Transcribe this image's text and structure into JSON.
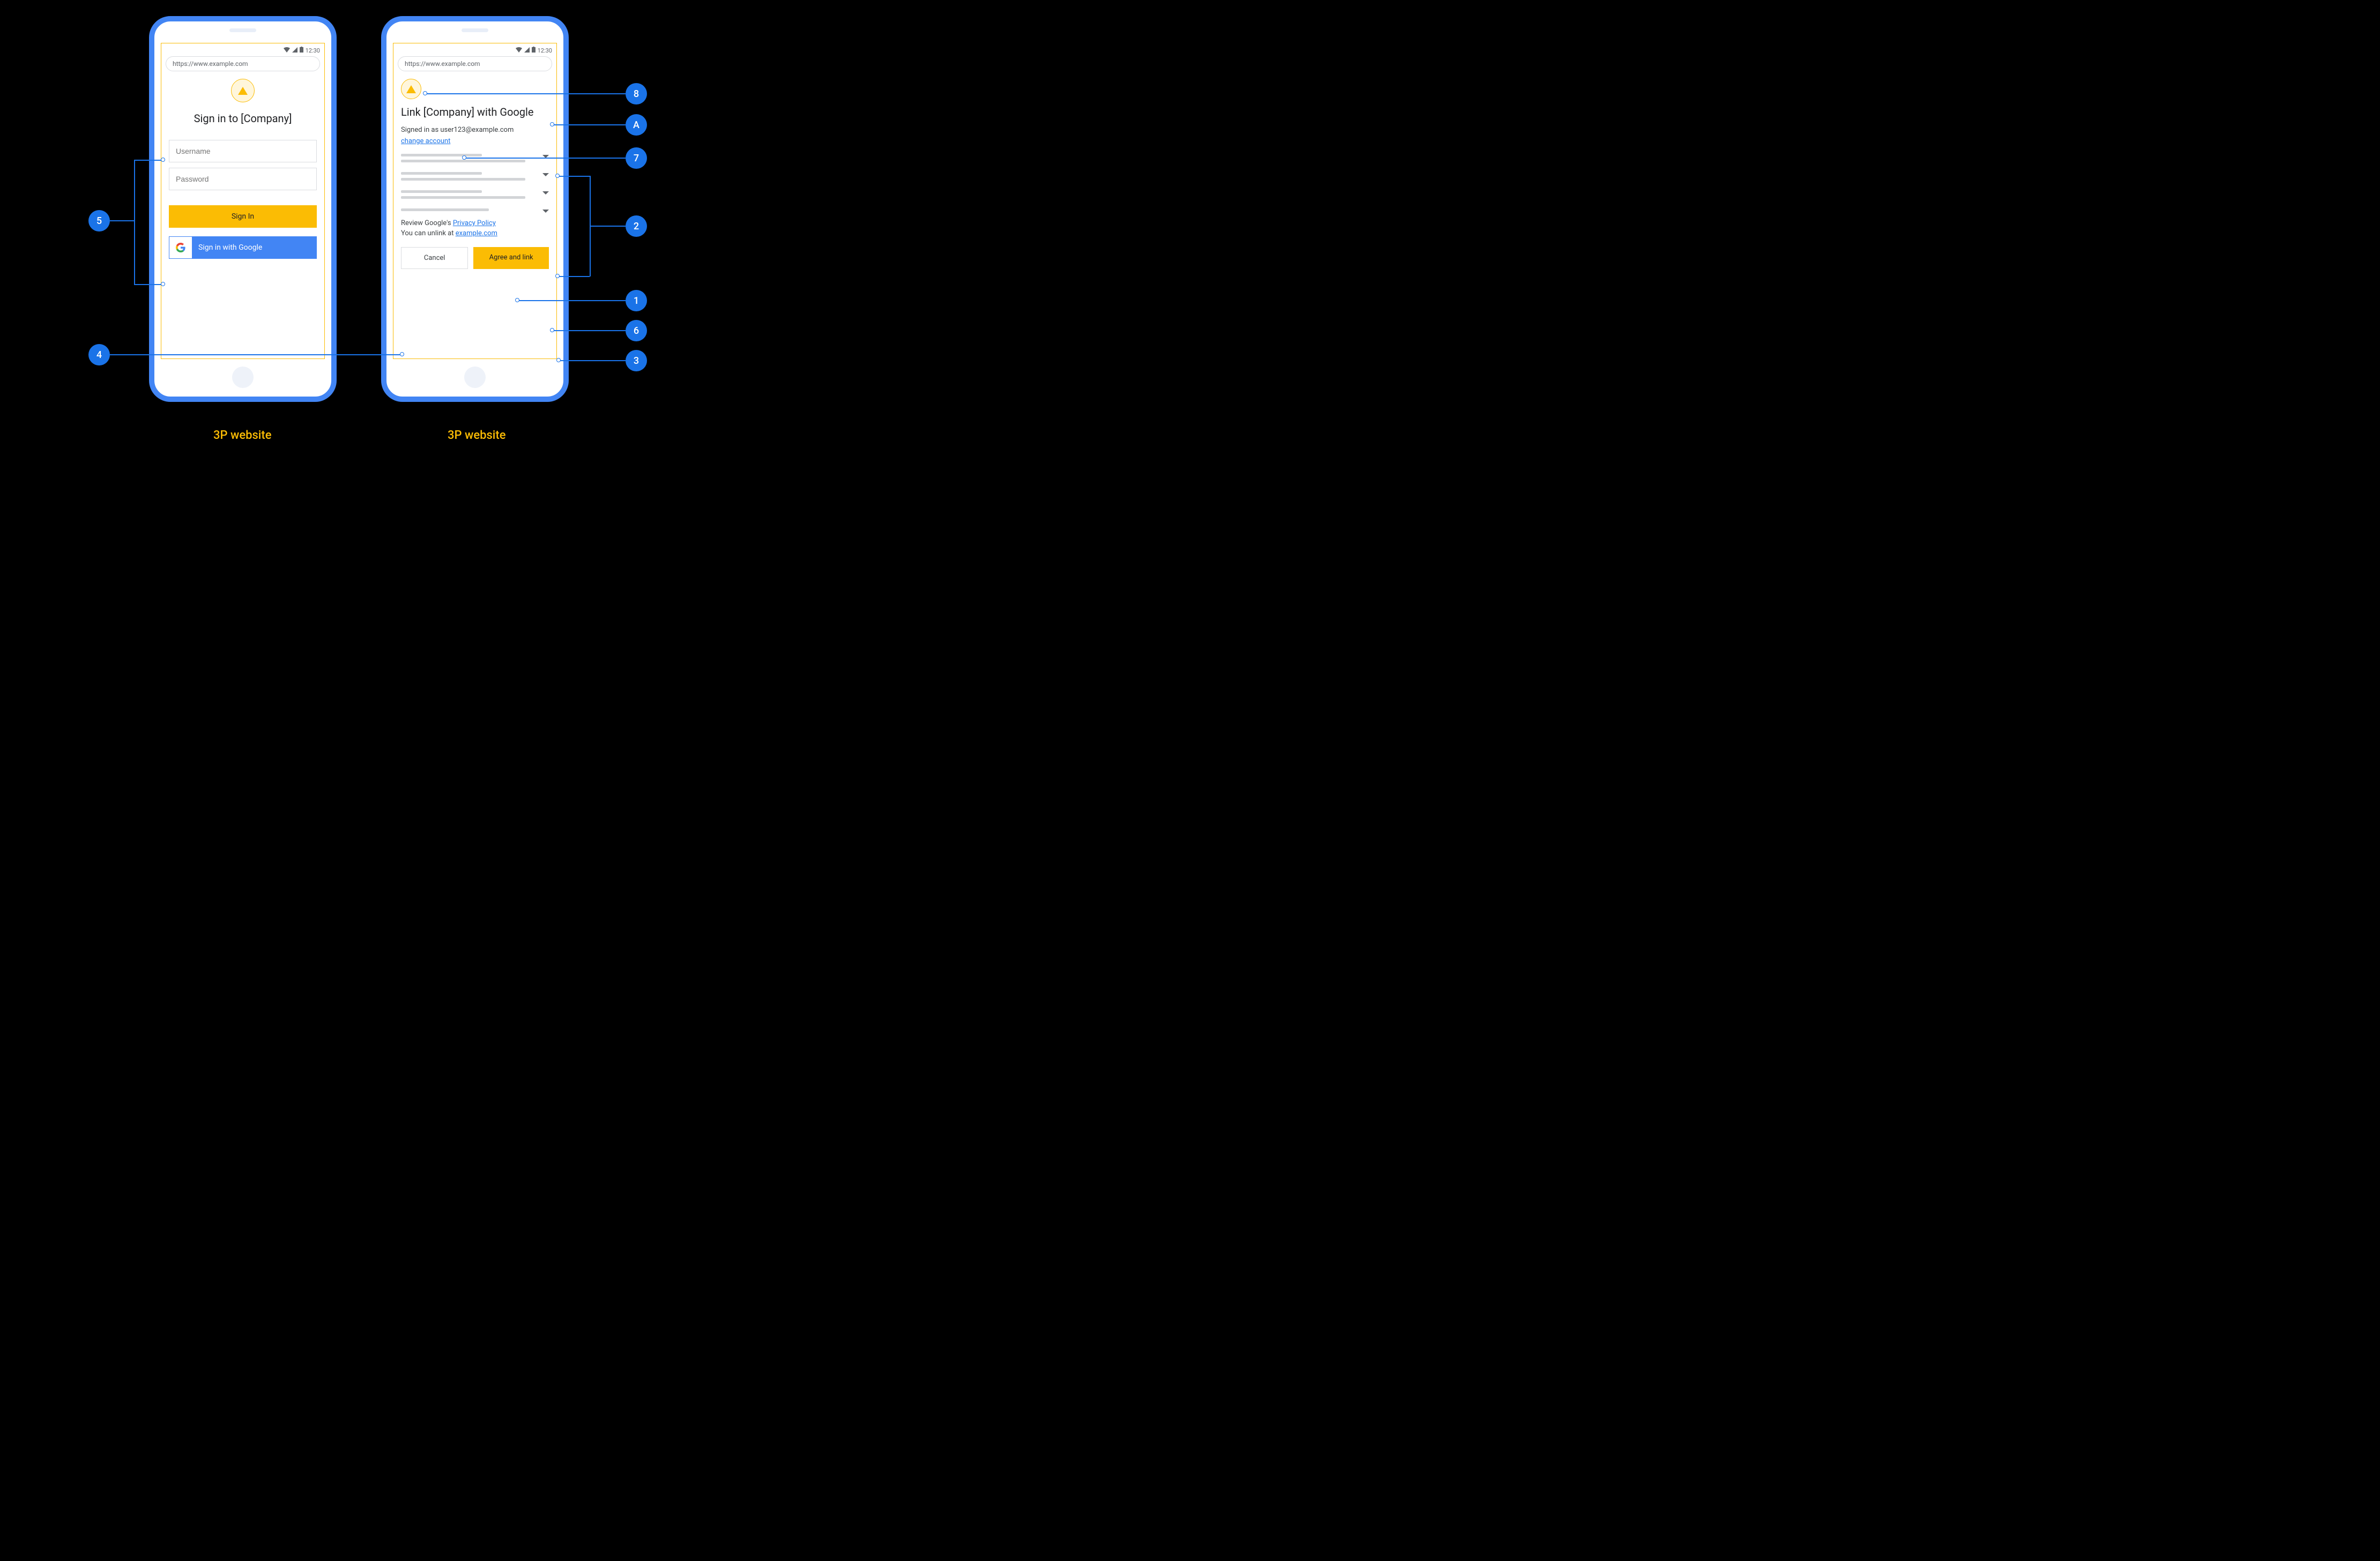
{
  "common": {
    "status_time": "12:30",
    "url": "https://www.example.com"
  },
  "phone1": {
    "caption": "3P website",
    "title": "Sign in to [Company]",
    "username_placeholder": "Username",
    "password_placeholder": "Password",
    "signin_label": "Sign In",
    "google_label": "Sign in with Google"
  },
  "phone2": {
    "caption": "3P website",
    "title": "Link [Company] with Google",
    "signed_in_text": "Signed in as user123@example.com",
    "change_account": "change account",
    "review_prefix": "Review Google's ",
    "privacy_policy": "Privacy Policy",
    "unlink_prefix": "You can unlink at ",
    "unlink_domain": "example.com",
    "cancel_label": "Cancel",
    "agree_label": "Agree and link"
  },
  "callouts": {
    "c5": "5",
    "c4": "4",
    "c8": "8",
    "cA": "A",
    "c7": "7",
    "c2": "2",
    "c1": "1",
    "c6": "6",
    "c3": "3"
  }
}
